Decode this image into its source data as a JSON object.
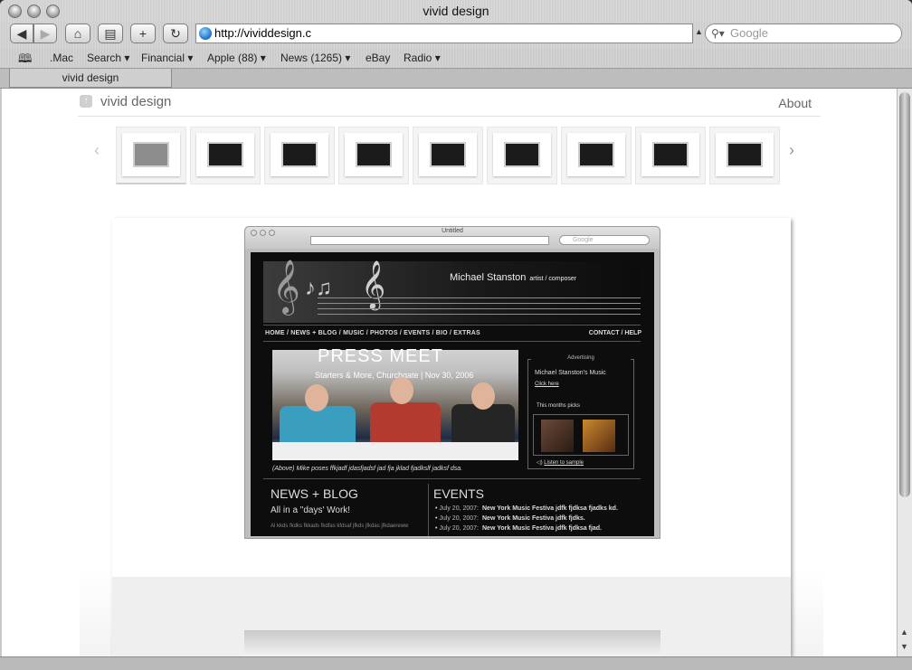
{
  "window": {
    "title": "vivid design"
  },
  "toolbar": {
    "url": "http://vividdesign.c",
    "search_placeholder": "Google",
    "new_tab_label": "+"
  },
  "bookmarks": [
    {
      "label": ".Mac"
    },
    {
      "label": "Search ▾"
    },
    {
      "label": "Financial ▾"
    },
    {
      "label": "Apple (88) ▾"
    },
    {
      "label": "News (1265) ▾"
    },
    {
      "label": "eBay"
    },
    {
      "label": "Radio ▾"
    }
  ],
  "tab": {
    "label": "vivid design"
  },
  "site": {
    "title": "vivid design",
    "about": "About",
    "thumbnail_count": 9,
    "selected_thumbnail": 1
  },
  "mock": {
    "window_title": "Untitled",
    "search_placeholder": "Google",
    "artist": "Michael Stanston",
    "artist_role": "artist / composer",
    "nav_left": "HOME  /  NEWS + BLOG  /  MUSIC  /  PHOTOS  /  EVENTS  /  BIO  /  EXTRAS",
    "nav_right": "CONTACT  /  HELP",
    "photo_title": "PRESS MEET",
    "photo_subtitle": "Starters & More, Churchgate  |  Nov 30, 2006",
    "caption": "(Above) Mike poses ffkjadf jdasfjadsf jad fja jklad fjadkslf jadksf dsa.",
    "ad_label": "Advertising",
    "ad_title": "Michael Stanston's Music",
    "ad_link": "Click here",
    "picks_label": "This months picks",
    "listen": "Listen to sample",
    "news_heading": "NEWS + BLOG",
    "news_sub": "All in a \"days' Work!",
    "news_text": "Al  kkds fkdks fkkads fkdfas kfdsaf jfkds jfkdas jfkdaereww",
    "events_heading": "EVENTS",
    "events": [
      {
        "date": "July 20, 2007:",
        "text": "New York Music Festiva jdfk fjdksa fjadks kd."
      },
      {
        "date": "July 20, 2007:",
        "text": "New York Music Festiva jdfk fjdks."
      },
      {
        "date": "July 20, 2007:",
        "text": "New York Music Festiva jdfk fjdksa fjad."
      }
    ]
  },
  "colors": {
    "site_text": "#666666",
    "mock_background": "#0d0d0d"
  }
}
